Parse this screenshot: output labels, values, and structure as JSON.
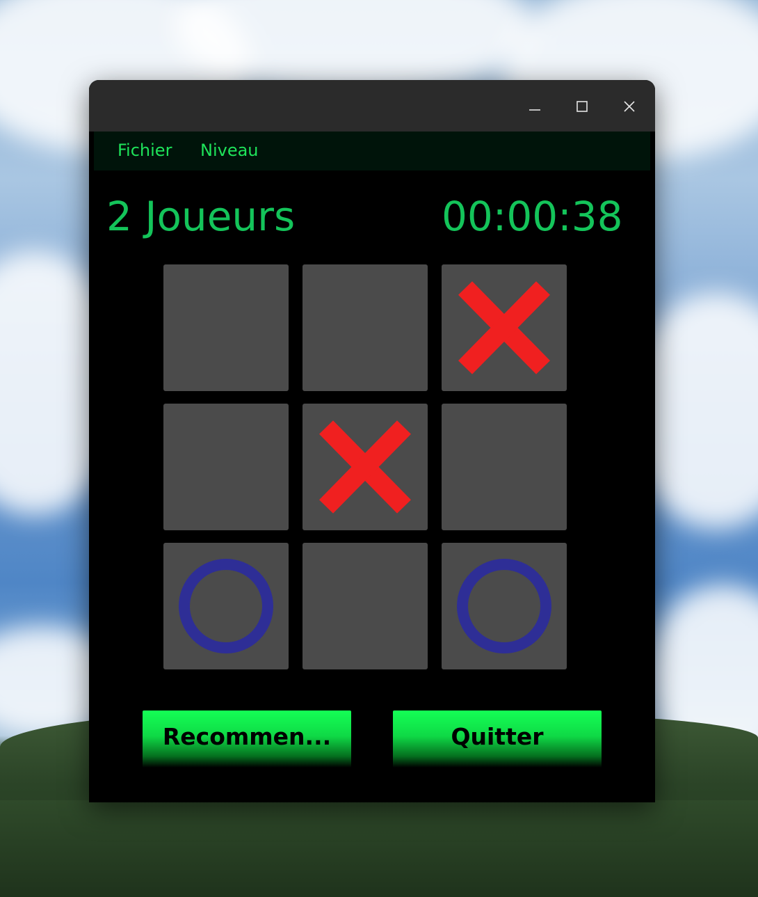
{
  "window": {
    "controls": {
      "minimize_icon": "minimize-icon",
      "maximize_icon": "maximize-icon",
      "close_icon": "close-icon"
    }
  },
  "menu": {
    "items": [
      {
        "label": "Fichier"
      },
      {
        "label": "Niveau"
      }
    ]
  },
  "game": {
    "mode": "2 Joueurs",
    "timer": "00:00:38",
    "board": [
      [
        "",
        "",
        "X"
      ],
      [
        "",
        "X",
        ""
      ],
      [
        "O",
        "",
        "O"
      ]
    ],
    "colors": {
      "x": "#f02020",
      "o": "#2e2e96",
      "cell": "#4b4b4b",
      "text": "#14c45a"
    }
  },
  "buttons": {
    "restart": "Recommen...",
    "quit": "Quitter"
  }
}
